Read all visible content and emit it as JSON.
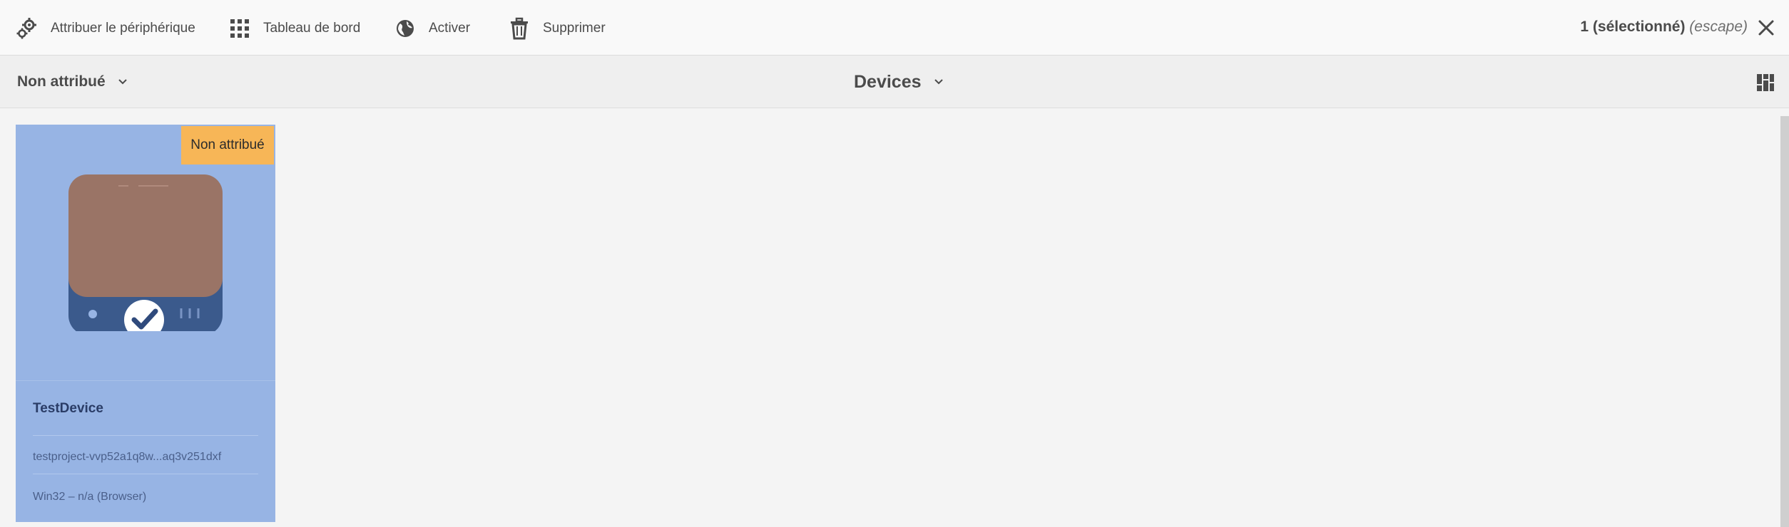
{
  "actionbar": {
    "actions": [
      {
        "label": "Attribuer le périphérique",
        "icon": "gears-icon"
      },
      {
        "label": "Tableau de bord",
        "icon": "grid-icon"
      },
      {
        "label": "Activer",
        "icon": "globe-icon"
      },
      {
        "label": "Supprimer",
        "icon": "trash-icon"
      }
    ],
    "selection_count": "1 (sélectionné)",
    "escape_hint": "(escape)",
    "close_icon": "close-icon"
  },
  "titlebar": {
    "filter_label": "Non attribué",
    "title": "Devices",
    "view_icon": "card-view-icon"
  },
  "cards": [
    {
      "badge": "Non attribué",
      "title": "TestDevice",
      "project": "testproject-vvp52a1q8w...aq3v251dxf",
      "platform": "Win32 – n/a (Browser)",
      "selected": true,
      "icon": "device-icon"
    }
  ],
  "colors": {
    "card_selected_bg": "#97b4e4",
    "badge_bg": "#f7b657",
    "device_screen": "#9a7466",
    "device_base": "#3b5a8c"
  }
}
